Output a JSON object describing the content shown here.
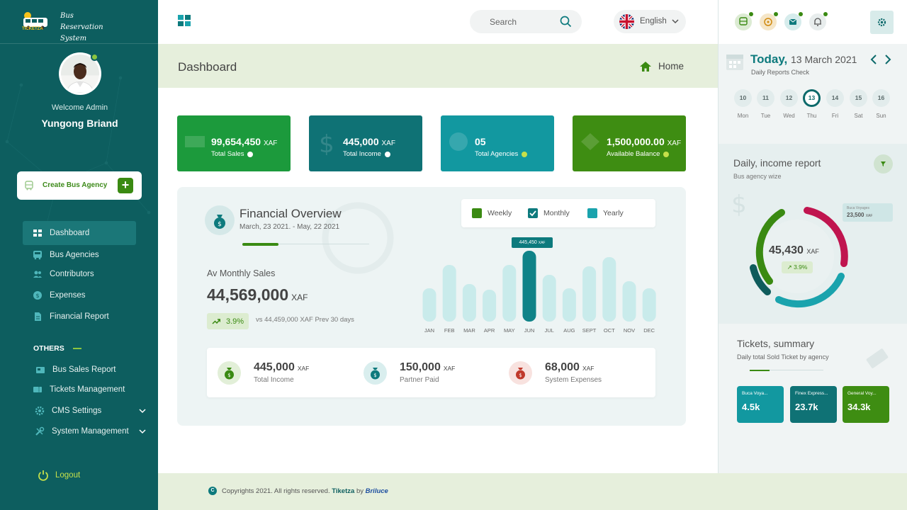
{
  "app": {
    "logo_text": "TICKETZA",
    "title_line1": "Bus Reservation",
    "title_line2": "System"
  },
  "user": {
    "welcome": "Welcome Admin",
    "name": "Yungong Briand"
  },
  "create_button": {
    "prefix": "Create",
    "label": " Bus Agency"
  },
  "nav": [
    {
      "label": "Dashboard",
      "icon": "grid-icon",
      "active": true
    },
    {
      "label": "Bus Agencies",
      "icon": "bus-icon"
    },
    {
      "label": "Contributors",
      "icon": "users-icon"
    },
    {
      "label": "Expenses",
      "icon": "money-icon"
    },
    {
      "label": "Financial Report",
      "icon": "document-icon"
    }
  ],
  "others_heading": "OTHERS",
  "others": [
    {
      "label": "Bus Sales Report",
      "icon": "report-icon"
    },
    {
      "label": "Tickets Management",
      "icon": "ticket-icon"
    },
    {
      "label": "CMS Settings",
      "icon": "gear-icon",
      "expandable": true
    },
    {
      "label": "System Management",
      "icon": "tools-icon",
      "expandable": true
    }
  ],
  "logout": "Logout",
  "header": {
    "search_placeholder": "Search",
    "language": "English"
  },
  "page": {
    "title": "Dashboard",
    "breadcrumb": "Home"
  },
  "stats": [
    {
      "value": "99,654,450",
      "unit": "XAF",
      "label": "Total Sales",
      "color": "#1c9a3c"
    },
    {
      "value": "445,000",
      "unit": "XAF",
      "label": "Total Income",
      "color": "#0f7275"
    },
    {
      "value": "05",
      "unit": "",
      "label": "Total Agencies",
      "color": "#1298a0"
    },
    {
      "value": "1,500,000.00",
      "unit": "XAF",
      "label": "Available Balance",
      "color": "#3e8d12"
    }
  ],
  "overview": {
    "title": "Financial Overview",
    "date_range": "March, 23 2021. -  May, 22 2021",
    "avg_label": "Av Monthly Sales",
    "avg_value": "44,569,000",
    "avg_unit": "XAF",
    "change": "3.9%",
    "comparison": "vs 44,459,000 XAF Prev 30 days",
    "legend": [
      {
        "label": "Weekly",
        "color": "#3a8a12",
        "checked": false
      },
      {
        "label": "Monthly",
        "color": "#0d7a7d",
        "checked": true
      },
      {
        "label": "Yearly",
        "color": "#1aa3ad",
        "checked": false
      }
    ],
    "tooltip_value": "445,450",
    "tooltip_unit": "XAF"
  },
  "chart_data": {
    "type": "bar",
    "categories": [
      "JAN",
      "FEB",
      "MAR",
      "APR",
      "MAY",
      "JUN",
      "JUL",
      "AUG",
      "SEPT",
      "OCT",
      "NOV",
      "DEC"
    ],
    "values": [
      47,
      80,
      53,
      45,
      80,
      100,
      66,
      47,
      78,
      91,
      57,
      47
    ],
    "highlight_index": 5,
    "colors": {
      "bar": "#c9ebeb",
      "highlight": "#0f8388"
    }
  },
  "summary": [
    {
      "value": "445,000",
      "unit": "XAF",
      "label": "Total Income",
      "icon": "money-bag-icon",
      "color": "#3a8a12",
      "bg": "#e2efd8"
    },
    {
      "value": "150,000",
      "unit": "XAF",
      "label": "Partner Paid",
      "icon": "money-bag-icon",
      "color": "#0d7a7d",
      "bg": "#d9eeee"
    },
    {
      "value": "68,000",
      "unit": "XAF",
      "label": "System Expenses",
      "icon": "money-bag-icon",
      "color": "#c0392b",
      "bg": "#f8e2df"
    }
  ],
  "footer": {
    "copyright": "Copyrights 2021. All rights reserved.",
    "brand": "Tiketza",
    "by": "by",
    "maker": "Briluce"
  },
  "calendar": {
    "today_label": "Today,",
    "date": "13 March 2021",
    "subtitle": "Daily Reports Check",
    "days": [
      {
        "num": "10",
        "name": "Mon"
      },
      {
        "num": "11",
        "name": "Tue"
      },
      {
        "num": "12",
        "name": "Wed"
      },
      {
        "num": "13",
        "name": "Thu",
        "selected": true
      },
      {
        "num": "14",
        "name": "Fri"
      },
      {
        "num": "15",
        "name": "Sat"
      },
      {
        "num": "16",
        "name": "Sun"
      }
    ]
  },
  "daily": {
    "title": "Daily,",
    "title_rest": " income report",
    "subtitle": "Bus agency wize",
    "value": "45,430",
    "unit": "XAF",
    "change": "3.9%",
    "callout_label": "Buca Voyages",
    "callout_value": "23,500",
    "callout_unit": "XAF"
  },
  "tickets": {
    "title": "Tickets,",
    "title_rest": " summary",
    "subtitle": "Daily total Sold Ticket by agency",
    "cards": [
      {
        "name": "Buca Voya...",
        "value": "4.5k",
        "color": "#1298a0"
      },
      {
        "name": "Finex Express...",
        "value": "23.7k",
        "color": "#0f7275"
      },
      {
        "name": "General Voy...",
        "value": "34.3k",
        "color": "#3e8d12"
      }
    ]
  }
}
